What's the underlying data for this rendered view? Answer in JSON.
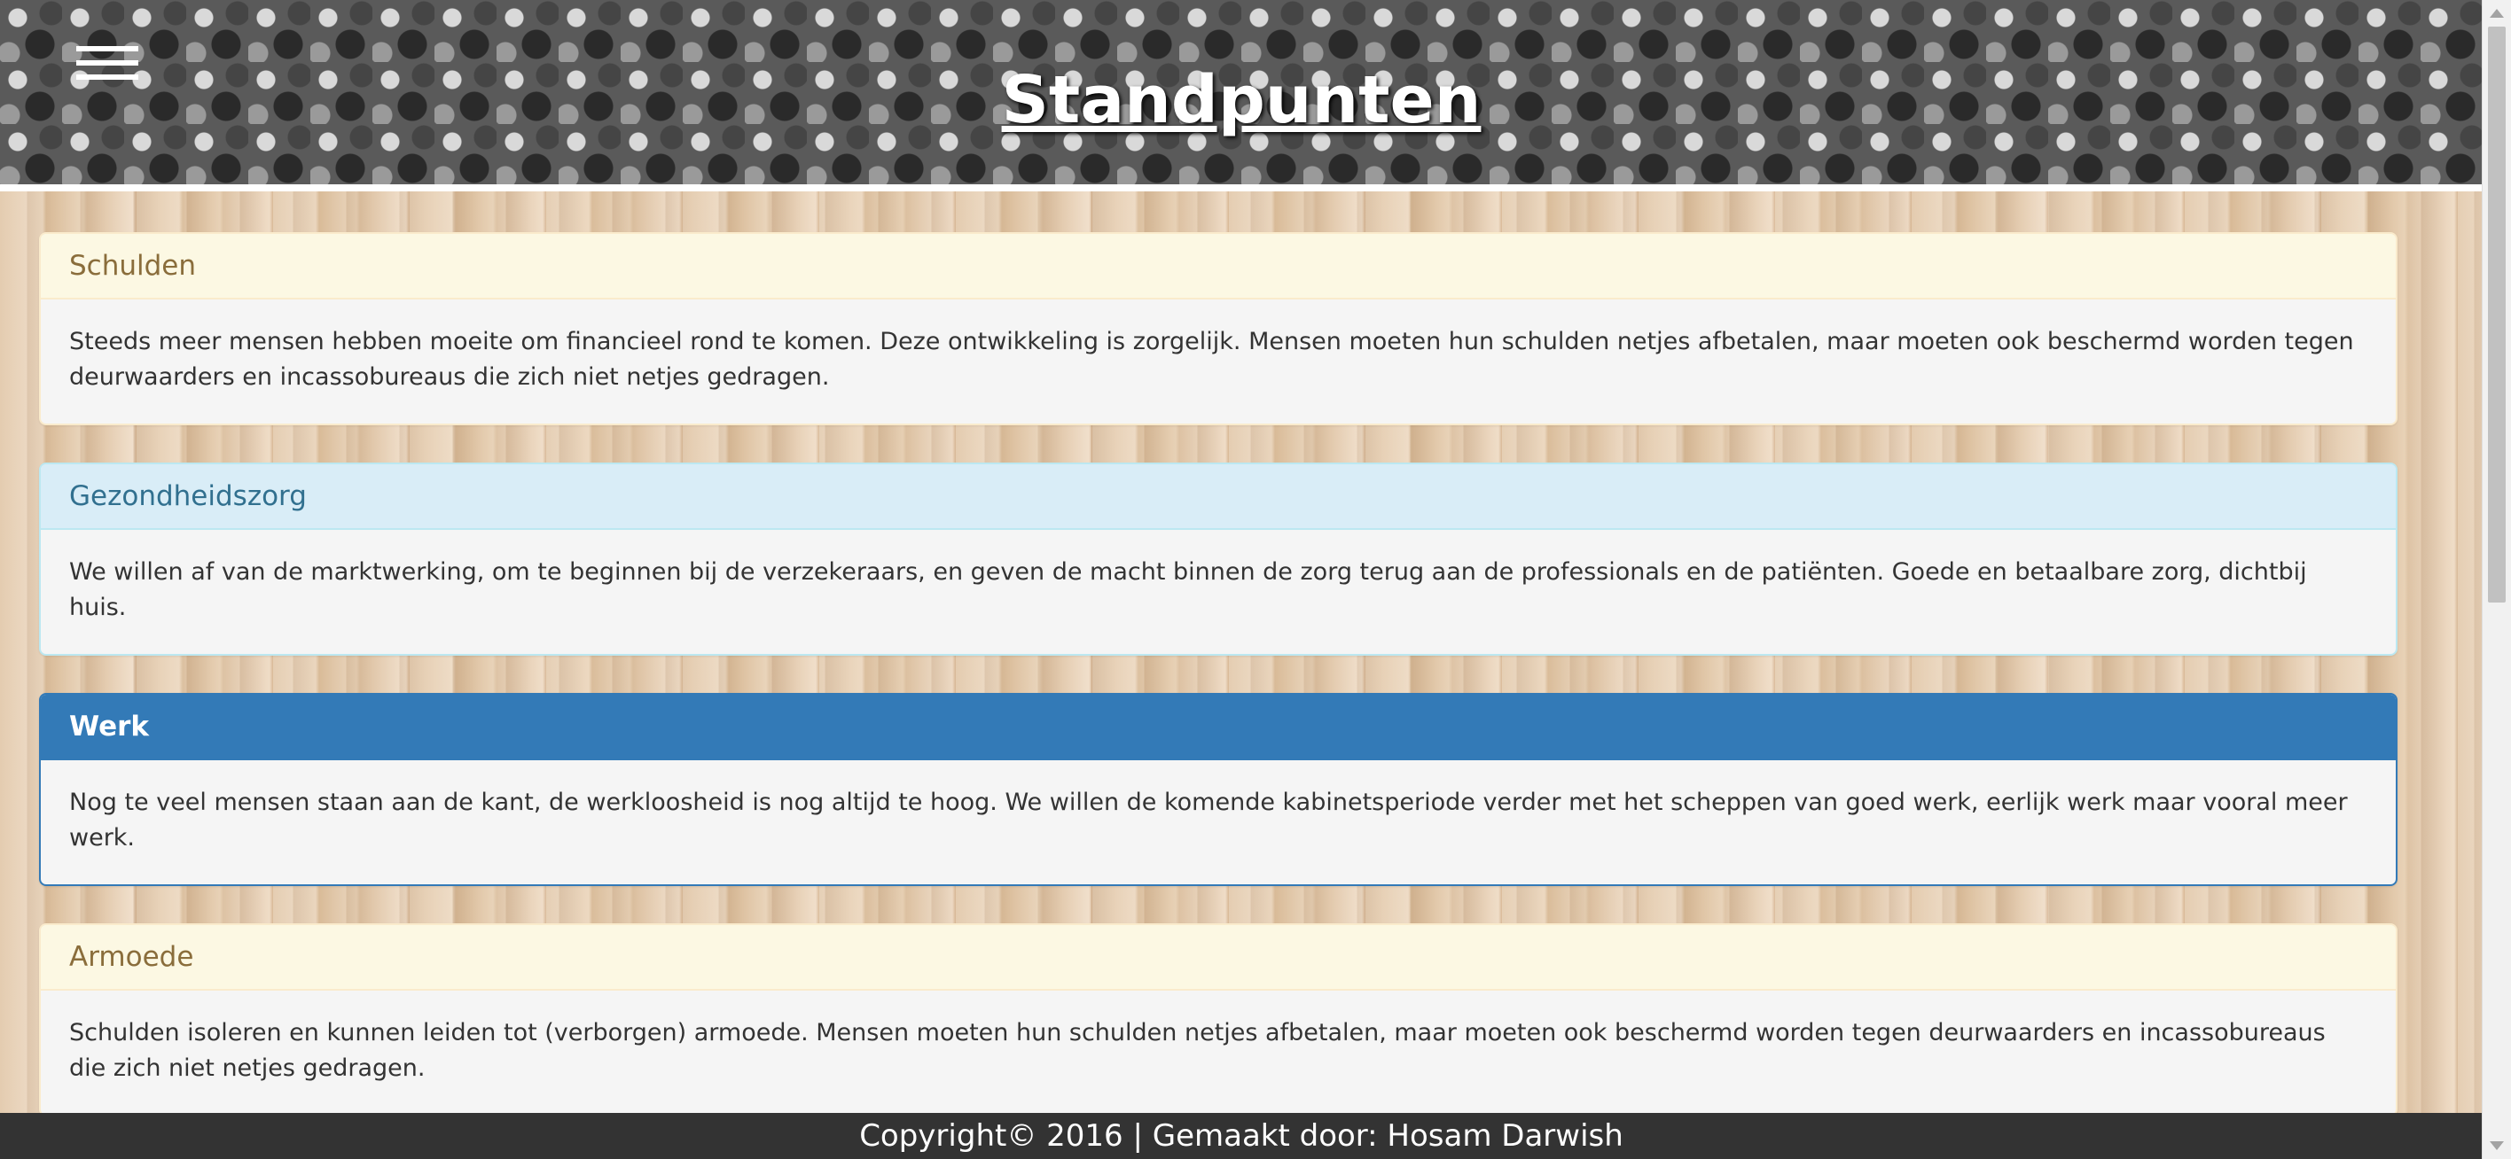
{
  "header": {
    "title": "Standpunten",
    "menu_icon": "hamburger-menu-icon"
  },
  "panels": [
    {
      "heading": "Schulden",
      "style": "warning",
      "body": "Steeds meer mensen hebben moeite om financieel rond te komen. Deze ontwikkeling is zorgelijk. Mensen moeten hun schulden netjes afbetalen, maar moeten ook beschermd worden tegen deurwaarders en incassobureaus die zich niet netjes gedragen."
    },
    {
      "heading": "Gezondheidszorg",
      "style": "info",
      "body": "We willen af van de marktwerking, om te beginnen bij de verzekeraars, en geven de macht binnen de zorg terug aan de professionals en de patiënten. Goede en betaalbare zorg, dichtbij huis."
    },
    {
      "heading": "Werk",
      "style": "primary",
      "body": "Nog te veel mensen staan aan de kant, de werkloosheid is nog altijd te hoog. We willen de komende kabinetsperiode verder met het scheppen van goed werk, eerlijk werk maar vooral meer werk."
    },
    {
      "heading": "Armoede",
      "style": "warning",
      "body": "Schulden isoleren en kunnen leiden tot (verborgen) armoede. Mensen moeten hun schulden netjes afbetalen, maar moeten ook beschermd worden tegen deurwaarders en incassobureaus die zich niet netjes gedragen."
    }
  ],
  "footer": {
    "text": "Copyright© 2016 | Gemaakt door: Hosam Darwish"
  },
  "colors": {
    "primary": "#337ab7",
    "info_bg": "#d9edf7",
    "warning_bg": "#fcf8e3",
    "footer_bg": "#333333"
  }
}
